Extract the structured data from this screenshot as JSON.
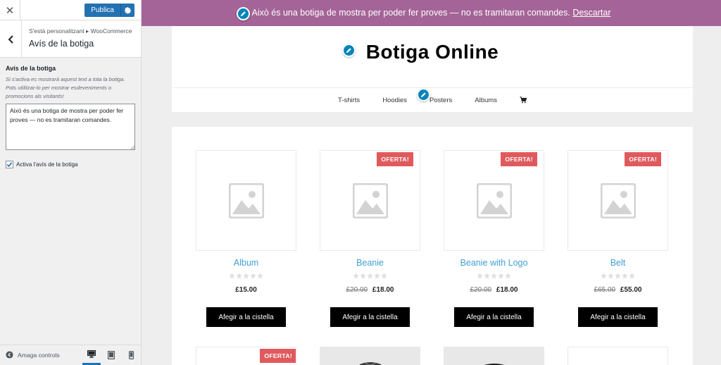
{
  "sidebar": {
    "close_label": "✕",
    "publish_label": "Publica",
    "breadcrumb": "S'està personalitzant ▸ WooCommerce",
    "section_title": "Avís de la botiga",
    "field_label": "Avís de la botiga",
    "field_description": "Si s'activa es mostrarà aquest text a tota la botiga. Pots utilitzar-lo per mostrar esdeveniments o promocions als visitants!",
    "textarea_value": "Això és una botiga de mostra per poder fer proves — no es tramitaran comandes.",
    "checkbox_label": "Activa l'avís de la botiga",
    "checkbox_checked": true,
    "collapse_label": "Amaga controls",
    "accent_color": "#2271b1"
  },
  "preview": {
    "store_notice": {
      "text": "Això és una botiga de mostra per poder fer proves — no es tramitaran comandes.",
      "dismiss_label": "Descartar",
      "background": "#a46497"
    },
    "site_title": "Botiga Online",
    "nav": {
      "items": [
        "T-shirts",
        "Hoodies",
        "Posters",
        "Albums"
      ],
      "cart_icon": "cart-icon"
    },
    "products": [
      {
        "name": "Album",
        "old_price": "",
        "price": "£15.00",
        "sale": false,
        "sale_label": ""
      },
      {
        "name": "Beanie",
        "old_price": "£20.00",
        "price": "£18.00",
        "sale": true,
        "sale_label": "OFERTA!"
      },
      {
        "name": "Beanie with Logo",
        "old_price": "£20.00",
        "price": "£18.00",
        "sale": true,
        "sale_label": "OFERTA!"
      },
      {
        "name": "Belt",
        "old_price": "£65.00",
        "price": "£55.00",
        "sale": true,
        "sale_label": "OFERTA!"
      }
    ],
    "add_to_cart_label": "Afegir a la cistella",
    "second_row_sale_label": "OFERTA!",
    "sale_color": "#e05a5d",
    "link_color": "#3f9fd6"
  }
}
